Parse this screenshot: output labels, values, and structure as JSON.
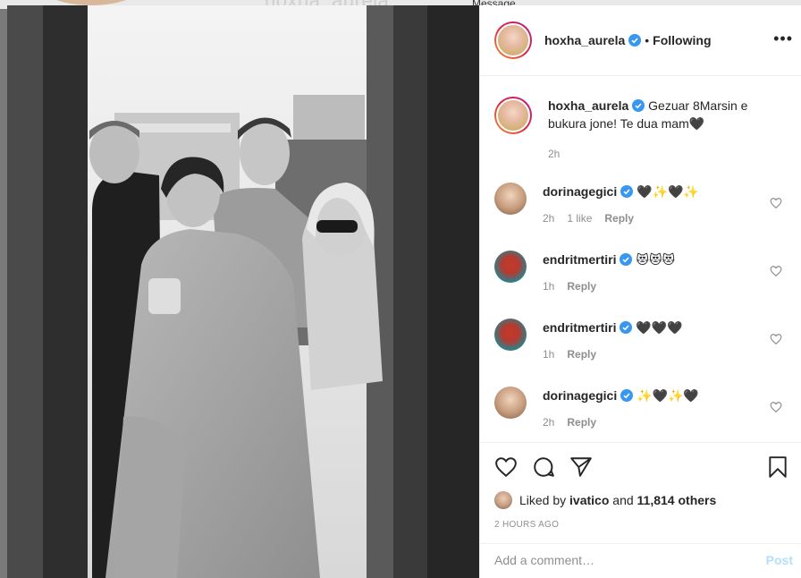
{
  "background": {
    "username": "hoxha_aurela",
    "message_label": "Message"
  },
  "post": {
    "author": "hoxha_aurela",
    "follow_status": "Following",
    "caption": "Gezuar 8Marsin e bukura jone! Te dua mam🖤",
    "caption_time": "2h",
    "likes_prefix": "Liked by",
    "liked_by": "ivatico",
    "likes_and": "and",
    "likes_count": "11,814 others",
    "time_ago": "2 HOURS AGO",
    "add_comment_placeholder": "Add a comment…",
    "post_label": "Post"
  },
  "comments": [
    {
      "user": "dorinagegici",
      "text": "🖤✨🖤✨",
      "time": "2h",
      "likes": "1 like",
      "reply": "Reply"
    },
    {
      "user": "endritmertiri",
      "text": "😻😻😻",
      "time": "1h",
      "likes": "",
      "reply": "Reply"
    },
    {
      "user": "endritmertiri",
      "text": "🖤🖤🖤",
      "time": "1h",
      "likes": "",
      "reply": "Reply"
    },
    {
      "user": "dorinagegici",
      "text": "✨🖤✨🖤",
      "time": "2h",
      "likes": "",
      "reply": "Reply"
    }
  ],
  "icons": {
    "like": "heart-icon",
    "comment": "comment-bubble-icon",
    "share": "paper-plane-icon",
    "save": "bookmark-icon",
    "more": "more-horizontal-icon",
    "verified": "verified-badge-icon"
  },
  "colors": {
    "verified": "#3897f0",
    "post_disabled": "#b2dffc",
    "secondary_text": "#8e8e8e"
  }
}
